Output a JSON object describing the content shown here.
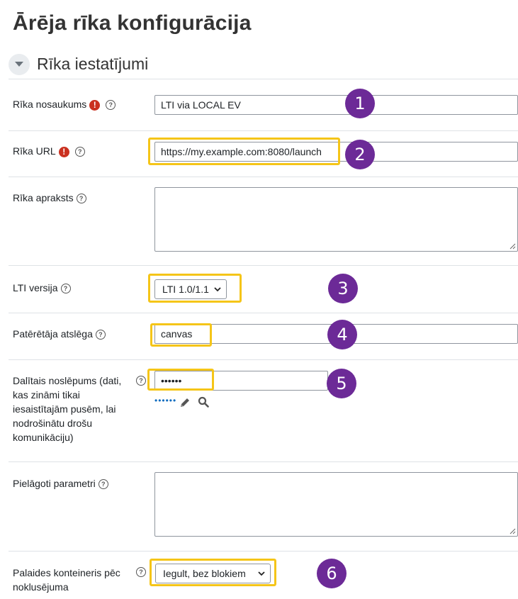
{
  "page": {
    "title": "Ārēja rīka konfigurācija"
  },
  "section": {
    "title": "Rīka iestatījumi"
  },
  "fields": {
    "tool_name": {
      "label": "Rīka nosaukums",
      "value": "LTI via LOCAL EV"
    },
    "tool_url": {
      "label": "Rīka URL",
      "value": "https://my.example.com:8080/launch"
    },
    "tool_description": {
      "label": "Rīka apraksts",
      "value": ""
    },
    "lti_version": {
      "label": "LTI versija",
      "value": "LTI 1.0/1.1"
    },
    "consumer_key": {
      "label": "Patērētāja atslēga",
      "value": "canvas"
    },
    "shared_secret": {
      "label": "Dalītais noslēpums (dati, kas zināmi tikai iesaistītajām pusēm, lai nodrošinātu drošu komunikāciju)",
      "value": "••••••",
      "masked_display": "••••••"
    },
    "custom_params": {
      "label": "Pielāgoti parametri",
      "value": ""
    },
    "launch_container": {
      "label": "Palaides konteineris pēc noklusējuma",
      "value": "Iegult, bez blokiem"
    }
  },
  "callouts": [
    "1",
    "2",
    "3",
    "4",
    "5",
    "6"
  ],
  "colors": {
    "highlight": "#f5c518",
    "callout": "#6c2a97",
    "required": "#ca3120",
    "link": "#0f6cbf"
  },
  "icons": {
    "required": "exclamation-icon",
    "help": "question-circle-icon",
    "edit": "pencil-icon",
    "reveal": "magnifier-icon",
    "collapse": "caret-down-icon",
    "select": "chevron-down-icon"
  }
}
